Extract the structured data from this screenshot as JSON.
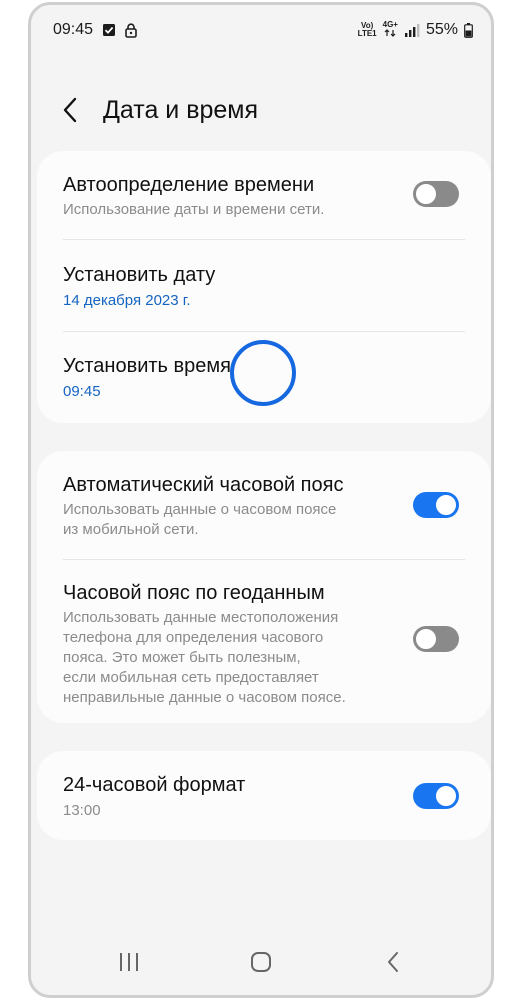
{
  "status_bar": {
    "time": "09:45",
    "network_top": "Vo)",
    "network_bottom": "LTE1",
    "data_type": "4G+",
    "battery": "55%"
  },
  "header": {
    "title": "Дата и время"
  },
  "card1": {
    "auto_time": {
      "title": "Автоопределение времени",
      "subtitle": "Использование даты и времени сети.",
      "enabled": false
    },
    "set_date": {
      "title": "Установить дату",
      "value": "14 декабря 2023 г."
    },
    "set_time": {
      "title": "Установить время",
      "value": "09:45"
    }
  },
  "card2": {
    "auto_timezone": {
      "title": "Автоматический часовой пояс",
      "subtitle_line1": "Использовать данные о часовом поясе",
      "subtitle_line2": "из мобильной сети.",
      "enabled": true
    },
    "geo_timezone": {
      "title": "Часовой пояс по геоданным",
      "subtitle_line1": "Использовать данные местоположения",
      "subtitle_line2": "телефона для определения часового",
      "subtitle_line3": "пояса. Это может быть полезным,",
      "subtitle_line4": "если мобильная сеть предоставляет",
      "subtitle_line5": "неправильные данные о часовом поясе.",
      "enabled": false
    }
  },
  "card3": {
    "format_24h": {
      "title": "24-часовой формат",
      "subtitle": "13:00",
      "enabled": true
    }
  },
  "colors": {
    "accent": "#1976f0",
    "link_blue": "#1565c0",
    "toggle_off": "#8a8a8a",
    "background": "#f4f4f4",
    "card": "#fcfcfc"
  },
  "icons": {
    "status_left": [
      "checkbox-icon",
      "lock-icon"
    ],
    "status_right": [
      "volte-icon",
      "data-arrows-icon",
      "signal-icon",
      "battery-icon"
    ],
    "header": "back-chevron-icon",
    "nav": [
      "recent-apps-icon",
      "home-icon",
      "back-icon"
    ]
  }
}
